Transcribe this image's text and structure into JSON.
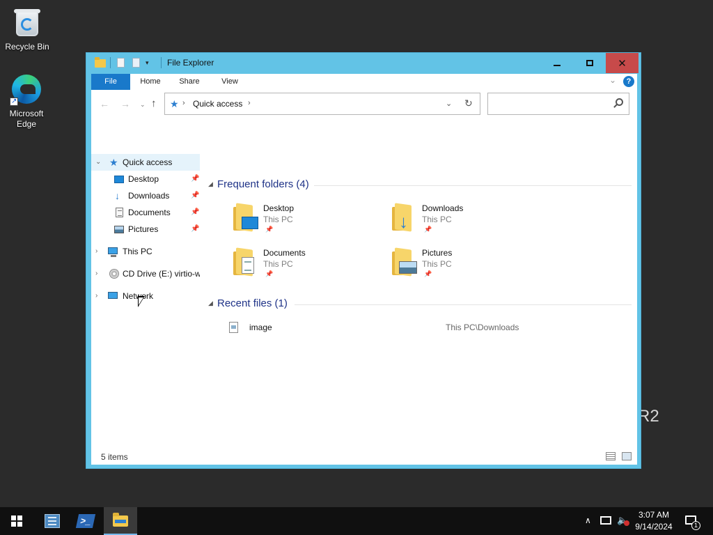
{
  "desktop": {
    "icons": [
      {
        "label": "Recycle Bin",
        "icon": "recycle-bin-icon"
      },
      {
        "label": "Microsoft Edge",
        "icon": "edge-icon"
      }
    ],
    "watermark": "R2"
  },
  "window": {
    "title": "File Explorer",
    "controls": {
      "minimize": "minimize",
      "maximize": "maximize",
      "close": "✕"
    },
    "ribbon": {
      "tabs": [
        "File",
        "Home",
        "Share",
        "View"
      ]
    },
    "address": {
      "crumb": "Quick access",
      "search_placeholder": ""
    },
    "nav_pane": {
      "items": [
        {
          "label": "Quick access",
          "icon": "star-icon",
          "expanded": true,
          "selected": true
        },
        {
          "label": "Desktop",
          "icon": "desktop-icon",
          "pinned": true
        },
        {
          "label": "Downloads",
          "icon": "download-icon",
          "pinned": true
        },
        {
          "label": "Documents",
          "icon": "document-icon",
          "pinned": true
        },
        {
          "label": "Pictures",
          "icon": "picture-icon",
          "pinned": true
        },
        {
          "label": "This PC",
          "icon": "computer-icon"
        },
        {
          "label": "CD Drive (E:) virtio-w",
          "icon": "cd-drive-icon"
        },
        {
          "label": "Network",
          "icon": "network-icon"
        }
      ]
    },
    "frequent": {
      "header": "Frequent folders (4)",
      "folders": [
        {
          "name": "Desktop",
          "location": "This PC"
        },
        {
          "name": "Downloads",
          "location": "This PC"
        },
        {
          "name": "Documents",
          "location": "This PC"
        },
        {
          "name": "Pictures",
          "location": "This PC"
        }
      ]
    },
    "recent": {
      "header": "Recent files (1)",
      "files": [
        {
          "name": "image",
          "path": "This PC\\Downloads"
        }
      ]
    },
    "status": {
      "items": "5 items"
    }
  },
  "taskbar": {
    "apps": [
      "start-icon",
      "server-manager-icon",
      "powershell-icon",
      "file-explorer-icon"
    ],
    "powershell_glyph": ">_",
    "tray": {
      "time": "3:07 AM",
      "date": "9/14/2024",
      "notification_count": "1"
    }
  },
  "colors": {
    "window_frame": "#62c3e6",
    "file_tab": "#1979ca",
    "close_button": "#c74a4a",
    "header_text": "#1e3287",
    "taskbar": "#101010"
  }
}
